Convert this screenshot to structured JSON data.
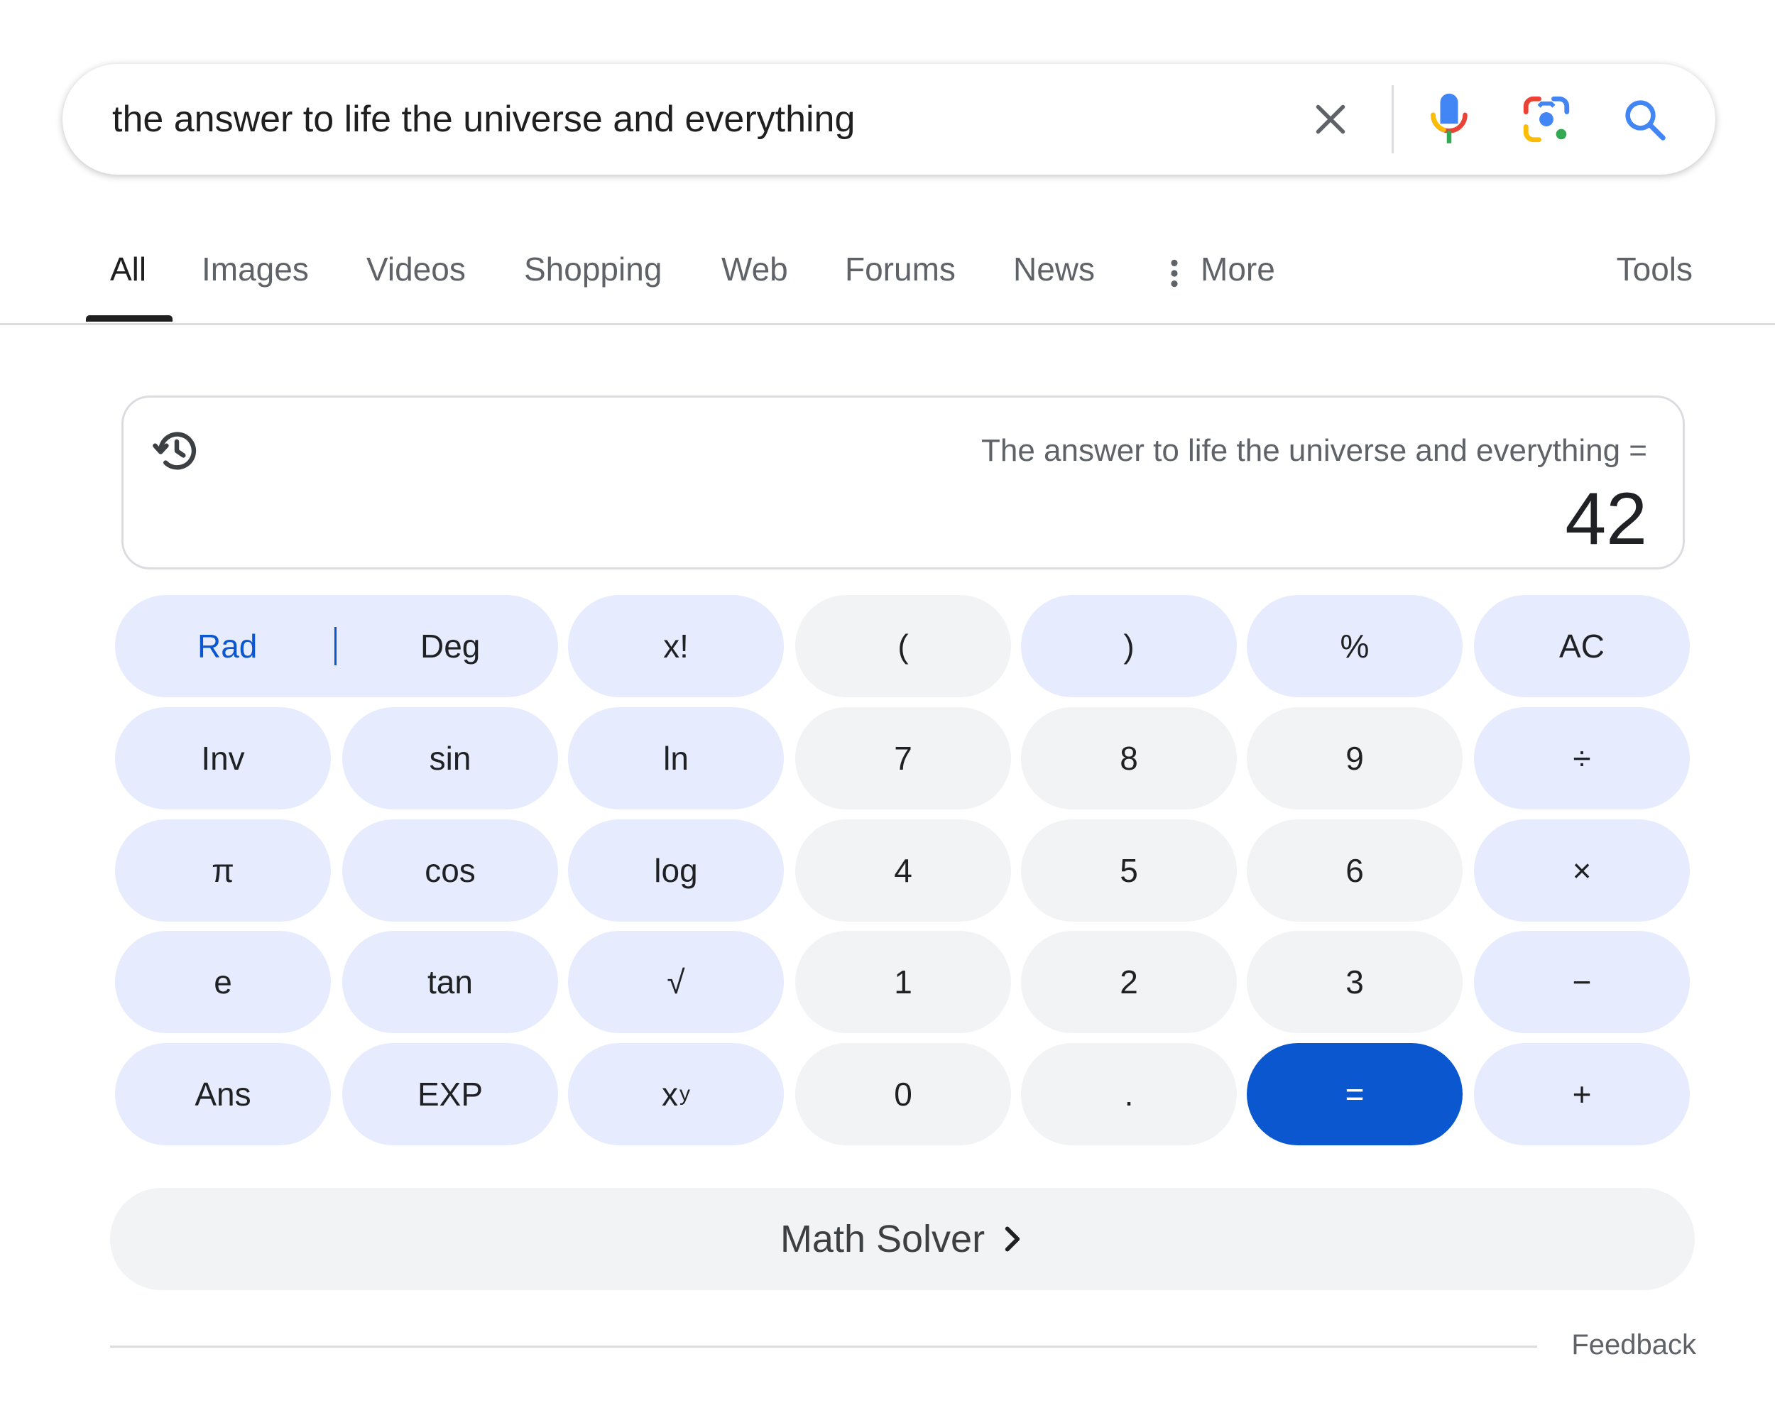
{
  "search": {
    "query": "the answer to life the universe and everything"
  },
  "tabs": [
    {
      "label": "All",
      "active": true
    },
    {
      "label": "Images"
    },
    {
      "label": "Videos"
    },
    {
      "label": "Shopping"
    },
    {
      "label": "Web"
    },
    {
      "label": "Forums"
    },
    {
      "label": "News"
    },
    {
      "label": "More"
    }
  ],
  "tools_label": "Tools",
  "calculator": {
    "expression": "The answer to life the universe and everything =",
    "result": "42",
    "keys": {
      "rad": "Rad",
      "deg": "Deg",
      "factorial": "x!",
      "lparen": "(",
      "rparen": ")",
      "percent": "%",
      "ac": "AC",
      "inv": "Inv",
      "sin": "sin",
      "ln": "ln",
      "seven": "7",
      "eight": "8",
      "nine": "9",
      "divide": "÷",
      "pi": "π",
      "cos": "cos",
      "log": "log",
      "four": "4",
      "five": "5",
      "six": "6",
      "multiply": "×",
      "e": "e",
      "tan": "tan",
      "sqrt": "√",
      "one": "1",
      "two": "2",
      "three": "3",
      "minus": "−",
      "ans": "Ans",
      "exp": "EXP",
      "power_base": "x",
      "power_exp": "y",
      "zero": "0",
      "dot": ".",
      "equals": "=",
      "plus": "+"
    }
  },
  "math_solver_label": "Math Solver",
  "feedback_label": "Feedback",
  "colors": {
    "accent_blue": "#0b57d0",
    "function_key_bg": "#e6ecfd",
    "number_key_bg": "#f1f3f4"
  },
  "icons": {
    "clear": "close-icon",
    "mic": "microphone-icon",
    "lens": "lens-camera-icon",
    "search": "search-icon",
    "more": "more-vert-icon",
    "history": "history-icon",
    "chevron": "chevron-right-icon"
  }
}
